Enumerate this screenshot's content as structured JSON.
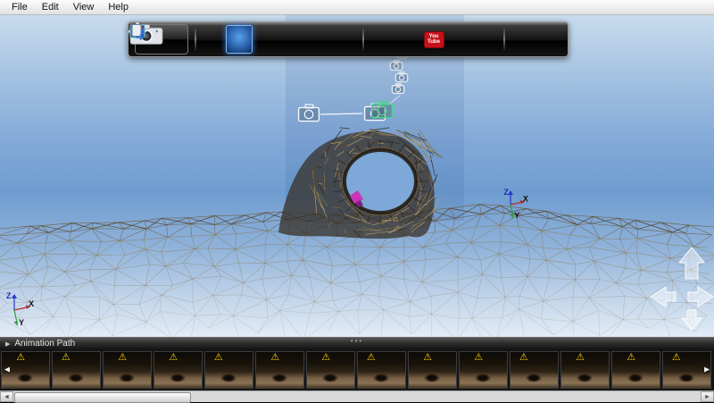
{
  "menu_bar": {
    "items": [
      {
        "label": "File"
      },
      {
        "label": "Edit"
      },
      {
        "label": "View"
      },
      {
        "label": "Help"
      }
    ]
  },
  "toolbar": {
    "youtube": {
      "line1": "You",
      "line2": "Tube"
    },
    "buttons": [
      {
        "name": "capture",
        "icon": "camera-large-icon"
      },
      {
        "name": "select",
        "icon": "cursor-icon"
      },
      {
        "name": "select-3d",
        "icon": "cursor-icon",
        "active": true
      },
      {
        "name": "pan",
        "icon": "move-arrows-icon"
      },
      {
        "name": "screen-view",
        "icon": "monitor-icon"
      },
      {
        "name": "orbit",
        "icon": "orbit-icon"
      },
      {
        "name": "photo-capture",
        "icon": "camera-gear-icon"
      },
      {
        "name": "material",
        "icon": "diamond-icon"
      },
      {
        "name": "email-share",
        "icon": "mail-icon"
      },
      {
        "name": "youtube-share",
        "icon": "youtube-icon"
      },
      {
        "name": "annotate",
        "icon": "pen-icon"
      },
      {
        "name": "slideshow",
        "icon": "swap-arrows-icon"
      },
      {
        "name": "cube-view",
        "icon": "rgb-cube-icon"
      },
      {
        "name": "export",
        "icon": "export-page-icon"
      }
    ]
  },
  "viewport": {
    "axis_gizmos": [
      {
        "position": "bottom-left",
        "labels": {
          "z": "Z",
          "x": "X",
          "y": "Y"
        }
      },
      {
        "position": "middle-right",
        "labels": {
          "z": "Z",
          "x": "X",
          "y": "Y"
        }
      }
    ],
    "colors": {
      "sky_mid": "#6f9cd0",
      "mesh_line": "#8d7c55",
      "mesh_dark": "#4e4028",
      "arch_fill": "#352c21",
      "camera_outline": "#ffffff",
      "camera_selected": "#3fe07a",
      "magenta_patch": "#c837b8"
    }
  },
  "animation_path": {
    "label": "Animation Path",
    "expander_icon": "▶",
    "grip_dots": "•••"
  },
  "filmstrip": {
    "count": 14,
    "warning_icon": "⚠",
    "prev_icon": "◄",
    "next_icon": "►"
  },
  "scrollbar": {
    "left_arrow": "◄",
    "right_arrow": "►"
  }
}
